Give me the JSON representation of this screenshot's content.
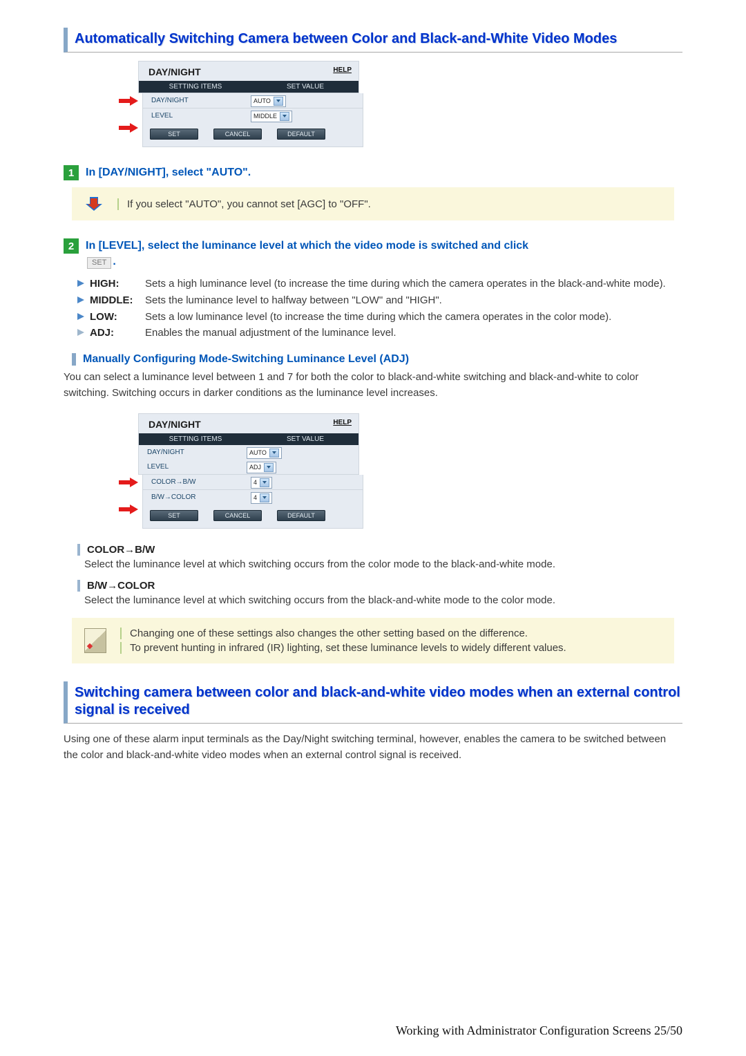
{
  "section1_title": "Automatically Switching Camera between Color and Black-and-White Video Modes",
  "screenshot1": {
    "title": "DAY/NIGHT",
    "help": "HELP",
    "col_items": "SETTING ITEMS",
    "col_value": "SET VALUE",
    "rows": [
      {
        "label": "DAY/NIGHT",
        "value": "AUTO",
        "arrow": true
      },
      {
        "label": "LEVEL",
        "value": "MIDDLE",
        "arrow": true
      }
    ],
    "btn_set": "SET",
    "btn_cancel": "CANCEL",
    "btn_default": "DEFAULT"
  },
  "step1_num": "1",
  "step1_text": "In [DAY/NIGHT], select \"AUTO\".",
  "note1": "If you select \"AUTO\", you cannot set [AGC] to \"OFF\".",
  "step2_num": "2",
  "step2_text_a": "In [LEVEL], select the luminance level at which the video mode is switched and click",
  "step2_btn": "SET",
  "step2_text_b": ".",
  "defs": [
    {
      "label": "HIGH:",
      "val": "Sets a high luminance level (to increase the time during which the camera operates in the black-and-white mode)."
    },
    {
      "label": "MIDDLE:",
      "val": "Sets the luminance level to halfway between \"LOW\" and \"HIGH\"."
    },
    {
      "label": "LOW:",
      "val": "Sets a low luminance level (to increase the time during which the camera operates in the color mode)."
    },
    {
      "label": "ADJ:",
      "val": "Enables the manual adjustment of the luminance level."
    }
  ],
  "subhead_adj": "Manually Configuring Mode-Switching Luminance Level (ADJ)",
  "adj_body": "You can select a luminance level between 1 and 7 for both the color to black-and-white switching and black-and-white to color switching. Switching occurs in darker conditions as the luminance level increases.",
  "screenshot2": {
    "title": "DAY/NIGHT",
    "help": "HELP",
    "col_items": "SETTING ITEMS",
    "col_value": "SET VALUE",
    "rows": [
      {
        "label": "DAY/NIGHT",
        "value": "AUTO",
        "arrow": false
      },
      {
        "label": "LEVEL",
        "value": "ADJ",
        "arrow": false
      },
      {
        "label": "COLOR→B/W",
        "value": "4",
        "arrow": true
      },
      {
        "label": "B/W→COLOR",
        "value": "4",
        "arrow": true
      }
    ],
    "btn_set": "SET",
    "btn_cancel": "CANCEL",
    "btn_default": "DEFAULT"
  },
  "thin1_head": "COLOR→B/W",
  "thin1_text": "Select the luminance level at which switching occurs from the color mode to the black-and-white mode.",
  "thin2_head": "B/W→COLOR",
  "thin2_text": "Select the luminance level at which switching occurs from the black-and-white mode to the color mode.",
  "note2a": "Changing one of these settings also changes the other setting based on the difference.",
  "note2b": "To prevent hunting in infrared (IR) lighting, set these luminance levels to widely different values.",
  "section2_title": "Switching camera between color and black-and-white video modes when an external control signal is received",
  "section2_body": "Using one of these alarm input terminals as the Day/Night switching terminal, however, enables the camera to be switched between the color and black-and-white video modes when an external control signal is received.",
  "footer": "Working with Administrator Configuration Screens 25/50"
}
